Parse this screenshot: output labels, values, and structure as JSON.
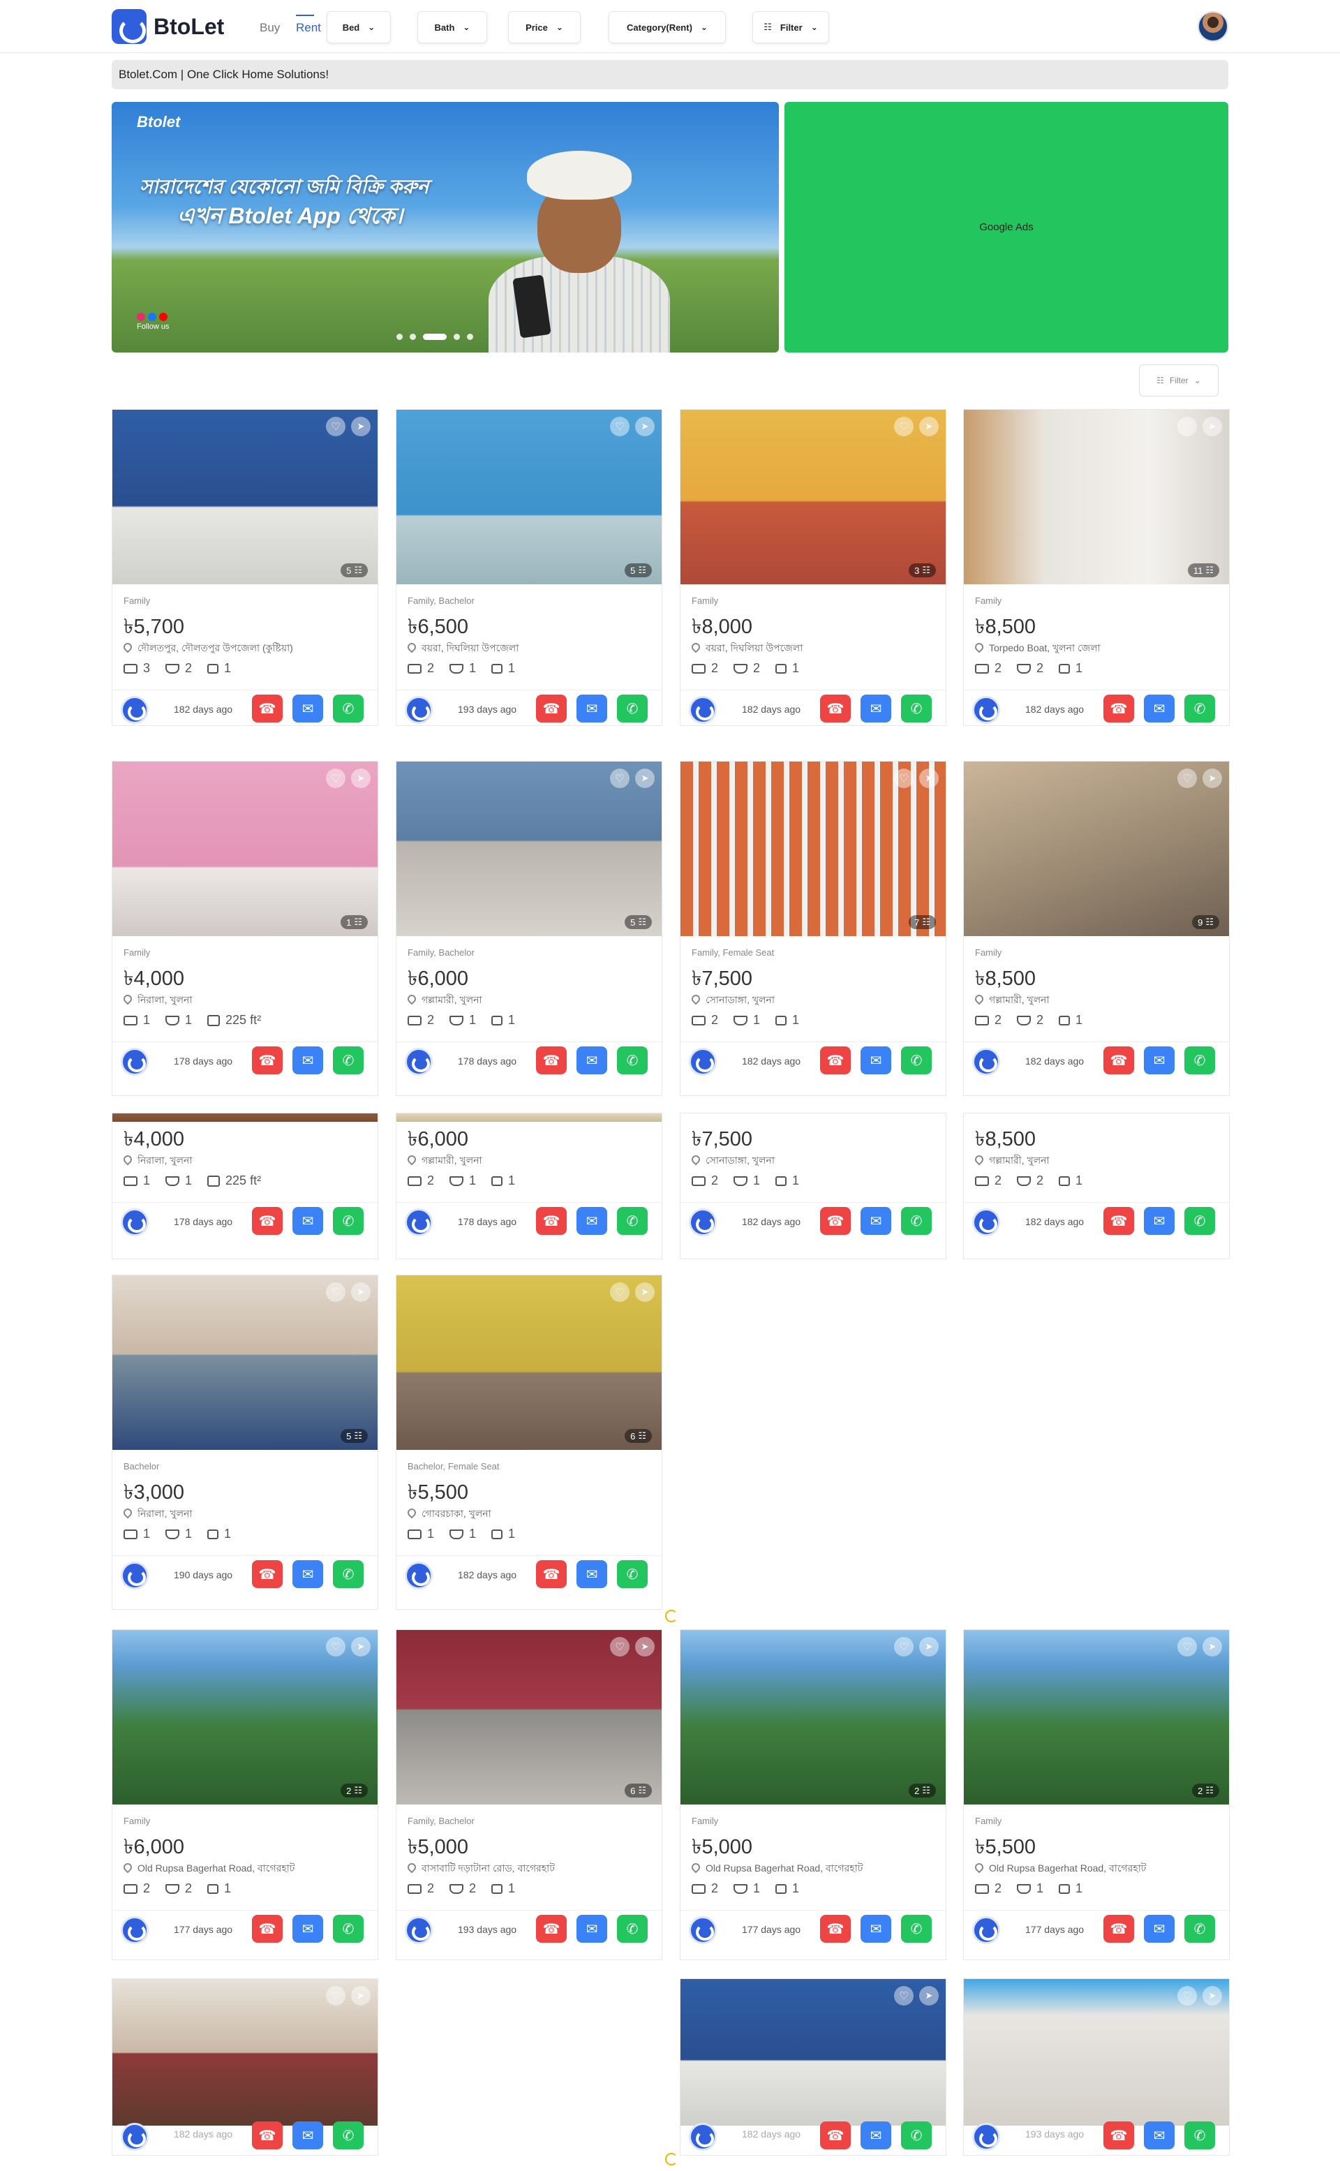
{
  "brand": {
    "name": "BtoLet"
  },
  "nav": {
    "buy": "Buy",
    "rent": "Rent",
    "bed": "Bed",
    "bath": "Bath",
    "price": "Price",
    "category": "Category(Rent)",
    "filter": "Filter"
  },
  "tagline": "Btolet.Com | One Click Home Solutions!",
  "banner": {
    "logo": "Btolet",
    "line1": "সারাদেশের যেকোনো জমি বিক্রি করুন",
    "line2": "এখন Btolet App থেকে।",
    "follow": "Follow us",
    "active_slide": 3,
    "slides": 5
  },
  "ads": {
    "label": "Google Ads"
  },
  "filter_button": "Filter",
  "icons": {
    "heart": "heart-icon",
    "share": "share-icon",
    "photos": "photo-count-icon",
    "call": "phone-icon",
    "mail": "email-icon",
    "whatsapp": "whatsapp-icon"
  },
  "colors": {
    "accent": "#2f5fdd",
    "call": "#ef4444",
    "mail": "#3b82f6",
    "whatsapp": "#22c55e",
    "ads": "#22c55e"
  },
  "listings": [
    {
      "category": "Family",
      "price": "৳5,700",
      "location": "দৌলতপুর, দৌলতপুর উপজেলা (কুষ্টিয়া)",
      "beds": "3",
      "baths": "2",
      "balcony": "1",
      "area": "",
      "posted": "182 days ago",
      "photos": "5"
    },
    {
      "category": "Family, Bachelor",
      "price": "৳6,500",
      "location": "বয়রা, দিঘলিয়া উপজেলা",
      "beds": "2",
      "baths": "1",
      "balcony": "1",
      "area": "",
      "posted": "193 days ago",
      "photos": "5"
    },
    {
      "category": "Family",
      "price": "৳8,000",
      "location": "বয়রা, দিঘলিয়া উপজেলা",
      "beds": "2",
      "baths": "2",
      "balcony": "1",
      "area": "",
      "posted": "182 days ago",
      "photos": "3"
    },
    {
      "category": "Family",
      "price": "৳8,500",
      "location": "Torpedo Boat, খুলনা জেলা",
      "beds": "2",
      "baths": "2",
      "balcony": "1",
      "area": "",
      "posted": "182 days ago",
      "photos": "11"
    },
    {
      "category": "Family",
      "price": "৳4,000",
      "location": "নিরালা, খুলনা",
      "beds": "1",
      "baths": "1",
      "balcony": "",
      "area": "225 ft²",
      "posted": "178 days ago",
      "photos": "1"
    },
    {
      "category": "Family, Bachelor",
      "price": "৳6,000",
      "location": "গল্লামারী, খুলনা",
      "beds": "2",
      "baths": "1",
      "balcony": "1",
      "area": "",
      "posted": "178 days ago",
      "photos": "5"
    },
    {
      "category": "Family, Female Seat",
      "price": "৳7,500",
      "location": "সোনাডাঙ্গা, খুলনা",
      "beds": "2",
      "baths": "1",
      "balcony": "1",
      "area": "",
      "posted": "182 days ago",
      "photos": "7"
    },
    {
      "category": "Family",
      "price": "৳8,500",
      "location": "গল্লামারী, খুলনা",
      "beds": "2",
      "baths": "2",
      "balcony": "1",
      "area": "",
      "posted": "182 days ago",
      "photos": "9"
    },
    {
      "category": "",
      "price": "৳4,000",
      "location": "নিরালা, খুলনা",
      "beds": "1",
      "baths": "1",
      "balcony": "",
      "area": "225 ft²",
      "posted": "178 days ago",
      "photos": ""
    },
    {
      "category": "",
      "price": "৳6,000",
      "location": "গল্লামারী, খুলনা",
      "beds": "2",
      "baths": "1",
      "balcony": "1",
      "area": "",
      "posted": "178 days ago",
      "photos": ""
    },
    {
      "category": "",
      "price": "৳7,500",
      "location": "সোনাডাঙ্গা, খুলনা",
      "beds": "2",
      "baths": "1",
      "balcony": "1",
      "area": "",
      "posted": "182 days ago",
      "photos": ""
    },
    {
      "category": "",
      "price": "৳8,500",
      "location": "গল্লামারী, খুলনা",
      "beds": "2",
      "baths": "2",
      "balcony": "1",
      "area": "",
      "posted": "182 days ago",
      "photos": ""
    },
    {
      "category": "Bachelor",
      "price": "৳3,000",
      "location": "নিরালা, খুলনা",
      "beds": "1",
      "baths": "1",
      "balcony": "1",
      "area": "",
      "posted": "190 days ago",
      "photos": "5"
    },
    {
      "category": "Bachelor, Female Seat",
      "price": "৳5,500",
      "location": "গোবরচাকা, খুলনা",
      "beds": "1",
      "baths": "1",
      "balcony": "1",
      "area": "",
      "posted": "182 days ago",
      "photos": "6"
    },
    {
      "category": "Family",
      "price": "৳5,000",
      "location": "Old Rupsa Bagerhat Road, বাগেরহাট",
      "beds": "2",
      "baths": "1",
      "balcony": "1",
      "area": "",
      "posted": "177 days ago",
      "photos": "2"
    },
    {
      "category": "Family",
      "price": "৳5,500",
      "location": "Old Rupsa Bagerhat Road, বাগেরহাট",
      "beds": "2",
      "baths": "1",
      "balcony": "1",
      "area": "",
      "posted": "177 days ago",
      "photos": "2"
    },
    {
      "category": "Family",
      "price": "৳6,000",
      "location": "Old Rupsa Bagerhat Road, বাগেরহাট",
      "beds": "2",
      "baths": "2",
      "balcony": "1",
      "area": "",
      "posted": "177 days ago",
      "photos": "2"
    },
    {
      "category": "Family, Bachelor",
      "price": "৳5,000",
      "location": "বাসাবাটি দড়াটানা রোড, বাগেরহাট",
      "beds": "2",
      "baths": "2",
      "balcony": "1",
      "area": "",
      "posted": "193 days ago",
      "photos": "6"
    },
    {
      "category": "",
      "price": "",
      "location": "",
      "beds": "",
      "baths": "",
      "balcony": "",
      "area": "",
      "posted": "182 days ago",
      "photos": ""
    },
    {
      "category": "",
      "price": "",
      "location": "",
      "beds": "",
      "baths": "",
      "balcony": "",
      "area": "",
      "posted": "193 days ago",
      "photos": ""
    },
    {
      "category": "",
      "price": "",
      "location": "",
      "beds": "",
      "baths": "",
      "balcony": "",
      "area": "",
      "posted": "182 days ago",
      "photos": ""
    }
  ]
}
